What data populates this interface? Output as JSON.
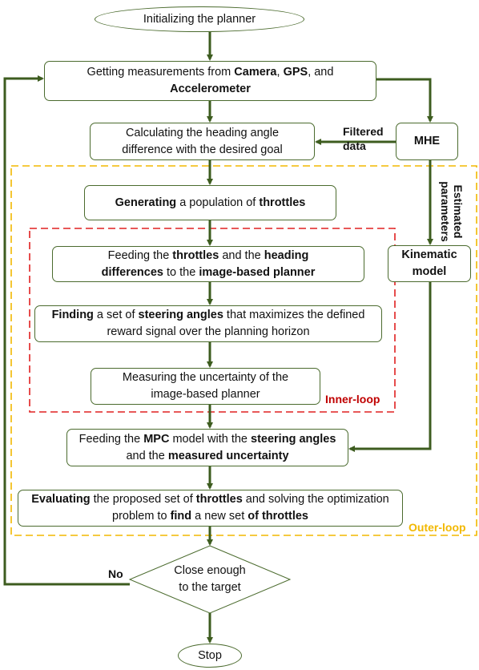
{
  "colors": {
    "flow_line": "#3d5c1f",
    "node_border": "#4b6b2e",
    "inner_loop": "#e02020",
    "outer_loop": "#f2b800",
    "inner_label": "#c00000",
    "outer_label": "#f2b800"
  },
  "nodes": {
    "start": [
      {
        "t": "Initializing the planner",
        "b": false
      }
    ],
    "measure": [
      {
        "t": "Getting measurements from ",
        "b": false
      },
      {
        "t": "Camera",
        "b": true
      },
      {
        "t": ", ",
        "b": false
      },
      {
        "t": "GPS",
        "b": true
      },
      {
        "t": ", and ",
        "b": false
      },
      {
        "t": "Accelerometer",
        "b": true
      }
    ],
    "heading": [
      {
        "t": "Calculating the heading angle difference with the desired goal",
        "b": false
      }
    ],
    "mhe": [
      {
        "t": "MHE",
        "b": true
      }
    ],
    "generate": [
      {
        "t": "Generating",
        "b": true
      },
      {
        "t": " a population of ",
        "b": false
      },
      {
        "t": "throttles",
        "b": true
      }
    ],
    "feed_planner": [
      {
        "t": "Feeding the ",
        "b": false
      },
      {
        "t": "throttles",
        "b": true
      },
      {
        "t": " and the ",
        "b": false
      },
      {
        "t": "heading differences",
        "b": true
      },
      {
        "t": " to the ",
        "b": false
      },
      {
        "t": "image-based planner",
        "b": true
      }
    ],
    "kinematic": [
      {
        "t": "Kinematic model",
        "b": true
      }
    ],
    "find": [
      {
        "t": "Finding",
        "b": true
      },
      {
        "t": " a set of ",
        "b": false
      },
      {
        "t": "steering angles",
        "b": true
      },
      {
        "t": " that maximizes the defined reward signal over the planning horizon",
        "b": false
      }
    ],
    "uncertainty": [
      {
        "t": "Measuring the uncertainty of the image-based planner",
        "b": false
      }
    ],
    "mpc": [
      {
        "t": "Feeding the ",
        "b": false
      },
      {
        "t": "MPC",
        "b": true
      },
      {
        "t": " model with the ",
        "b": false
      },
      {
        "t": "steering angles",
        "b": true
      },
      {
        "t": " and the ",
        "b": false
      },
      {
        "t": "measured uncertainty",
        "b": true
      }
    ],
    "evaluate": [
      {
        "t": "Evaluating",
        "b": true
      },
      {
        "t": " the proposed set of ",
        "b": false
      },
      {
        "t": "throttles",
        "b": true
      },
      {
        "t": " and solving the optimization problem to ",
        "b": false
      },
      {
        "t": "find",
        "b": true
      },
      {
        "t": " a new set ",
        "b": false
      },
      {
        "t": "of throttles",
        "b": true
      }
    ],
    "decision": [
      {
        "t": "Close enough to the target",
        "b": false
      }
    ],
    "stop": [
      {
        "t": "Stop",
        "b": false
      }
    ]
  },
  "labels": {
    "filtered_data": "Filtered data",
    "estimated_parameters": "Estimated parameters",
    "inner_loop": "Inner-loop",
    "outer_loop": "Outer-loop",
    "no": "No"
  }
}
